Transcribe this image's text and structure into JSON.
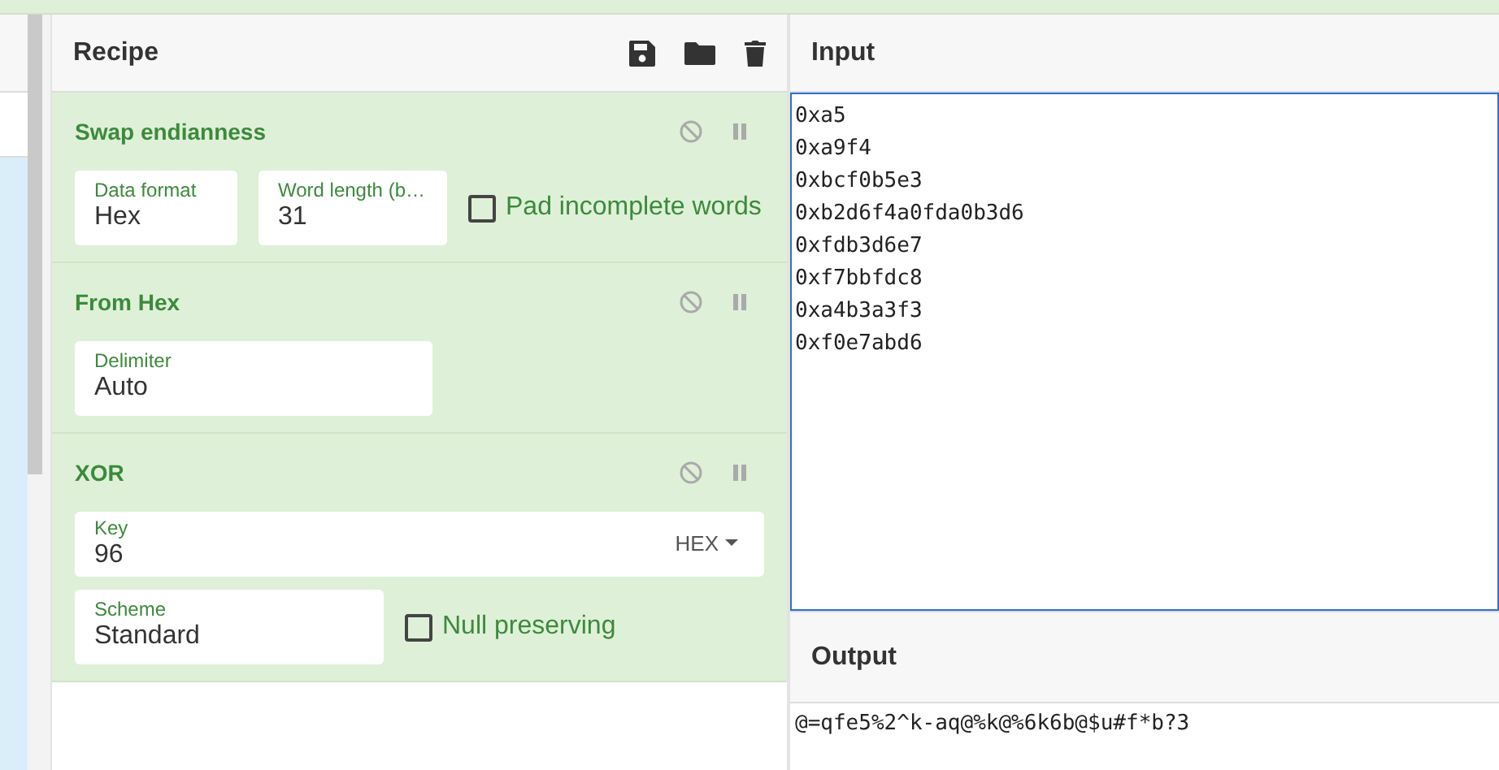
{
  "recipe": {
    "title": "Recipe",
    "operations": [
      {
        "name": "Swap endianness",
        "disabled": false,
        "breakpoint": false,
        "args": [
          {
            "kind": "field",
            "label": "Data format",
            "value": "Hex"
          },
          {
            "kind": "field",
            "label": "Word length (b…",
            "value": "31"
          },
          {
            "kind": "checkbox",
            "label": "Pad incomplete words",
            "checked": false
          }
        ]
      },
      {
        "name": "From Hex",
        "disabled": false,
        "breakpoint": false,
        "args": [
          {
            "kind": "field",
            "label": "Delimiter",
            "value": "Auto"
          }
        ]
      },
      {
        "name": "XOR",
        "disabled": false,
        "breakpoint": false,
        "args": [
          {
            "kind": "toggle_field",
            "label": "Key",
            "value": "96",
            "toggle": "HEX"
          },
          {
            "kind": "field",
            "label": "Scheme",
            "value": "Standard"
          },
          {
            "kind": "checkbox",
            "label": "Null preserving",
            "checked": false
          }
        ]
      }
    ]
  },
  "input": {
    "title": "Input",
    "lines": [
      "0xa5",
      "0xa9f4",
      "0xbcf0b5e3",
      "0xb2d6f4a0fda0b3d6",
      "0xfdb3d6e7",
      "0xf7bbfdc8",
      "0xa4b3a3f3",
      "0xf0e7abd6"
    ]
  },
  "output": {
    "title": "Output",
    "text": "@=qfe5%2^k-aq@%k@%6k6b@$u#f*b?3"
  }
}
